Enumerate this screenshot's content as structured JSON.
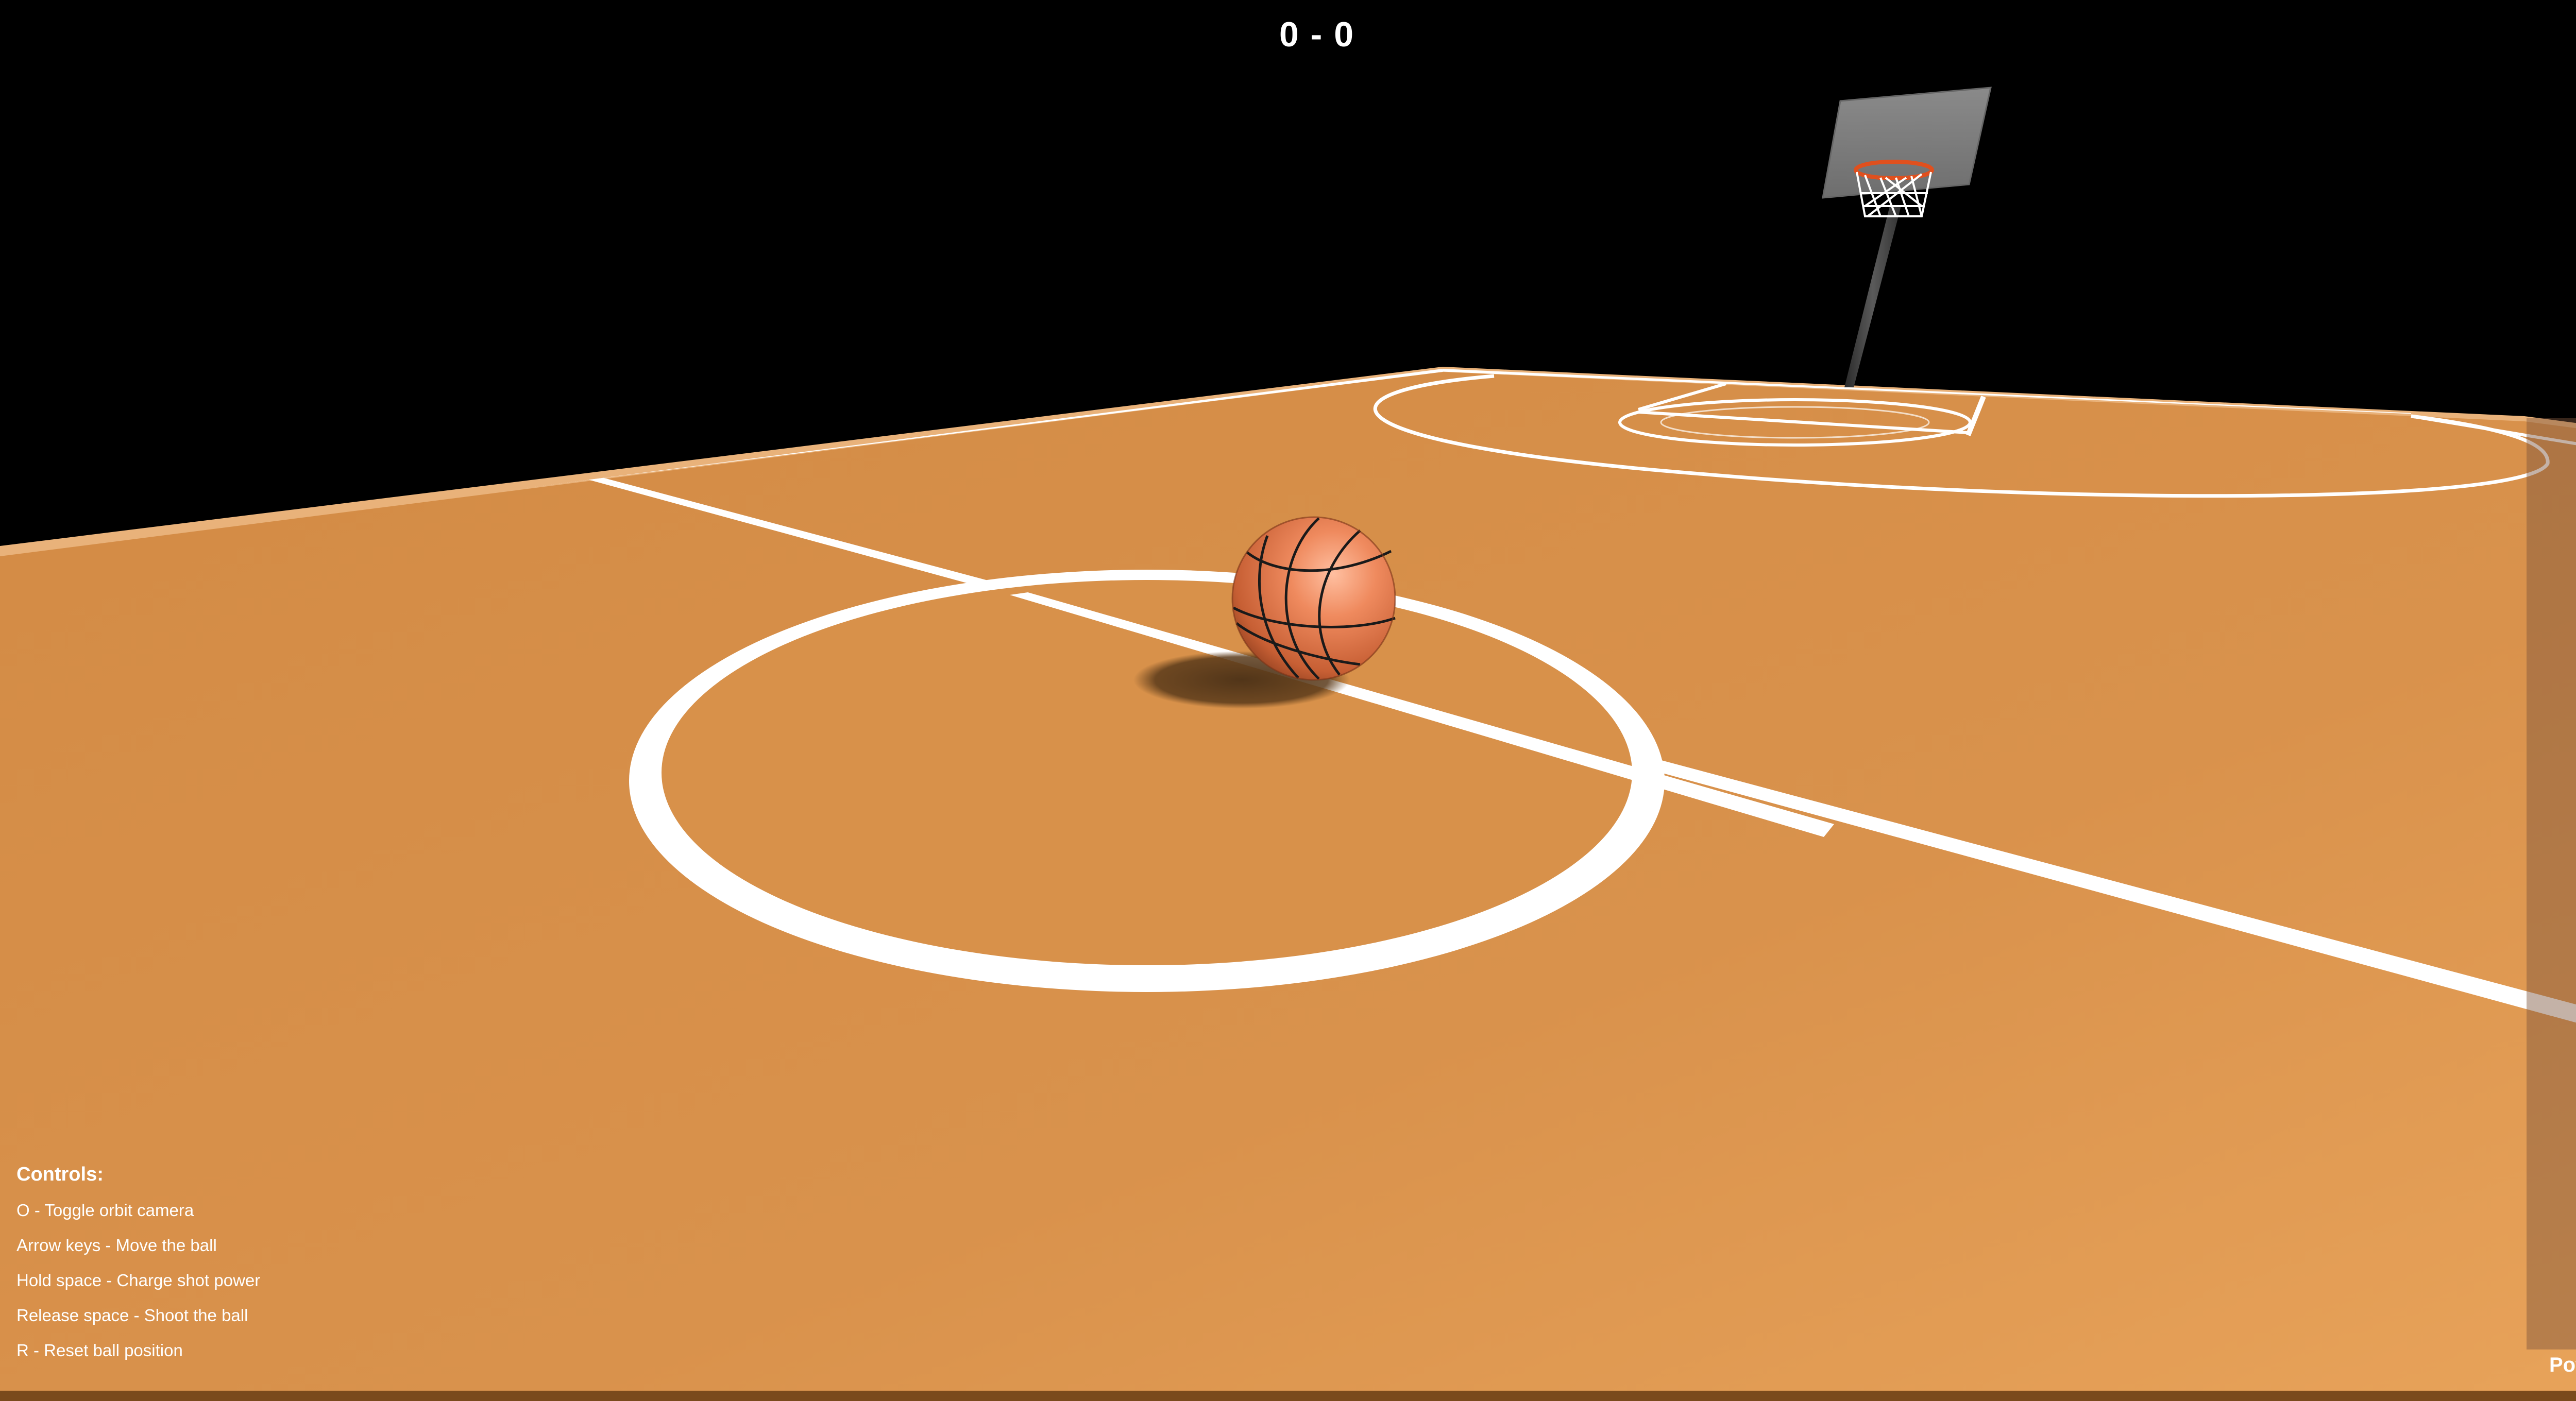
{
  "score": "0 - 0",
  "controls": {
    "heading": "Controls:",
    "items": [
      "O - Toggle orbit camera",
      "Arrow keys - Move the ball",
      "Hold space - Charge shot power",
      "Release space - Shoot the ball",
      "R - Reset ball position"
    ]
  },
  "power": {
    "label": "Power",
    "level": 0
  },
  "colors": {
    "background": "#000000",
    "court": "#d8914a",
    "court_lines": "#ffffff",
    "ball": "#e07a4a",
    "ball_seams": "#1a1a1a",
    "backboard": "#808080",
    "rim": "#e0501e",
    "power_track": "#7d553c"
  },
  "scene": {
    "objects": [
      "court",
      "center-circle",
      "half-court-line",
      "basketball",
      "ball-shadow",
      "hoop-backboard",
      "hoop-rim",
      "hoop-net",
      "hoop-pole",
      "free-throw-area",
      "three-point-arc"
    ]
  }
}
